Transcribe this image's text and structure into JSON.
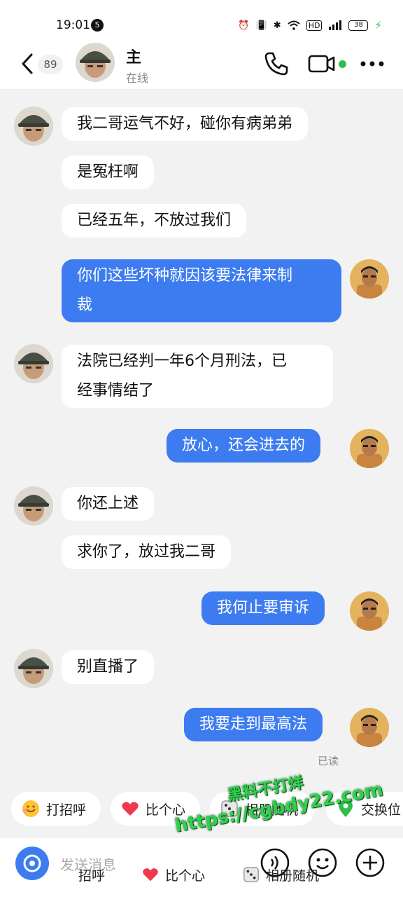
{
  "status_bar": {
    "time": "19:01",
    "notif_count": "5",
    "battery": "38"
  },
  "header": {
    "unread_count": "89",
    "contact_name": "主",
    "contact_status": "在线"
  },
  "messages": [
    {
      "side": "left",
      "text": "我二哥运气不好，碰你有病弟弟"
    },
    {
      "side": "left",
      "text": "是冤枉啊"
    },
    {
      "side": "left",
      "text": "已经五年，不放过我们"
    },
    {
      "side": "right",
      "lines": [
        "你们这些坏种就因该要法律来制",
        "裁"
      ]
    },
    {
      "side": "left",
      "lines": [
        "法院已经判一年6个月刑法，已",
        "经事情结了"
      ]
    },
    {
      "side": "right",
      "text": "放心，还会进去的"
    },
    {
      "side": "left",
      "text": "你还上述"
    },
    {
      "side": "left",
      "text": "求你了，放过我二哥"
    },
    {
      "side": "right",
      "text": "我何止要审诉"
    },
    {
      "side": "left",
      "text": "别直播了"
    },
    {
      "side": "right",
      "text": "我要走到最高法"
    }
  ],
  "read_receipt": "已读",
  "quick_actions": [
    {
      "label": "打招呼",
      "icon": "smile-hug-icon"
    },
    {
      "label": "比个心",
      "icon": "heart-icon"
    },
    {
      "label": "相册随机",
      "icon": "dice-icon"
    },
    {
      "label": "交换位",
      "icon": "location-pin-icon"
    }
  ],
  "input": {
    "placeholder": "发送消息"
  },
  "ghost_row": {
    "hello_text": "招呼",
    "heart_text": "比个心",
    "album_text": "相册随机"
  },
  "watermark": {
    "line1": "黑料不打烊",
    "line2": "https://cgbdy22.com"
  },
  "colors": {
    "accent": "#3d7cf0",
    "online": "#2fbf48",
    "watermark": "#2fd14a"
  }
}
